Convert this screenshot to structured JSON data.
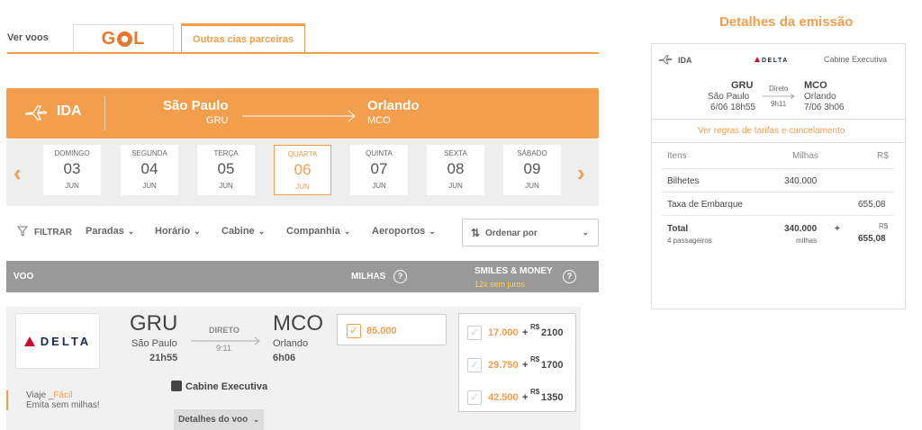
{
  "tabs": {
    "ver_voos": "Ver voos",
    "gol": "GOL",
    "outras": "Outras cias parceiras"
  },
  "banner": {
    "direction": "IDA",
    "origin_city": "São Paulo",
    "origin_code": "GRU",
    "dest_city": "Orlando",
    "dest_code": "MCO"
  },
  "dates": [
    {
      "weekday": "DOMINGO",
      "day": "03",
      "month": "JUN"
    },
    {
      "weekday": "SEGUNDA",
      "day": "04",
      "month": "JUN"
    },
    {
      "weekday": "TERÇA",
      "day": "05",
      "month": "JUN"
    },
    {
      "weekday": "QUARTA",
      "day": "06",
      "month": "JUN",
      "selected": true
    },
    {
      "weekday": "QUINTA",
      "day": "07",
      "month": "JUN"
    },
    {
      "weekday": "SEXTA",
      "day": "08",
      "month": "JUN"
    },
    {
      "weekday": "SÁBADO",
      "day": "09",
      "month": "JUN"
    }
  ],
  "filters": {
    "label": "FILTRAR",
    "items": [
      "Paradas",
      "Horário",
      "Cabine",
      "Companhia",
      "Aeroportos"
    ],
    "sort_label": "Ordenar por"
  },
  "table_header": {
    "voo": "VOO",
    "milhas": "MILHAS",
    "smiles_money": "SMILES & MONEY",
    "juros": "12x sem juros"
  },
  "flight": {
    "airline": "DELTA",
    "origin_code": "GRU",
    "origin_city": "São Paulo",
    "origin_time": "21h55",
    "stop_label": "DIRETO",
    "duration": "9:11",
    "dest_code": "MCO",
    "dest_city": "Orlando",
    "dest_time": "6h06",
    "cabin": "Cabine Executiva",
    "details_label": "Detalhes do voo",
    "viaje_facil": "Viaje",
    "viaje_facil_2": "Fácil",
    "emita": "Emita sem milhas!",
    "milhas_value": "85.000",
    "smiles_options": [
      {
        "miles": "17.000",
        "money": "2100"
      },
      {
        "miles": "29.750",
        "money": "1700"
      },
      {
        "miles": "42.500",
        "money": "1350"
      }
    ],
    "plus": "+",
    "currency": "R$"
  },
  "panel": {
    "title": "Detalhes da emissão",
    "direction": "IDA",
    "airline": "DELTA",
    "cabin": "Cabine Executiva",
    "origin_code": "GRU",
    "origin_city": "São Paulo",
    "origin_datetime": "6/06 18h55",
    "stop": "Direto",
    "duration": "9h11",
    "dest_code": "MCO",
    "dest_city": "Orlando",
    "dest_datetime": "7/06 3h06",
    "regras": "Ver regras de tarifas e cancelamento",
    "col_items": "Itens",
    "col_milhas": "Milhas",
    "col_rs": "R$",
    "row1_label": "Bilhetes",
    "row1_milhas": "340.000",
    "row2_label": "Taxa de Embarque",
    "row2_rs": "655,08",
    "total_label": "Total",
    "total_passengers": "4 passageiros",
    "total_milhas": "340.000",
    "total_milhas_unit": "milhas",
    "total_plus": "+",
    "total_rs_unit": "R$",
    "total_rs": "655,08"
  },
  "colors": {
    "accent": "#f29e4c",
    "header_gray": "#999999",
    "delta_red": "#c8102e",
    "delta_navy": "#1a2b4c"
  }
}
